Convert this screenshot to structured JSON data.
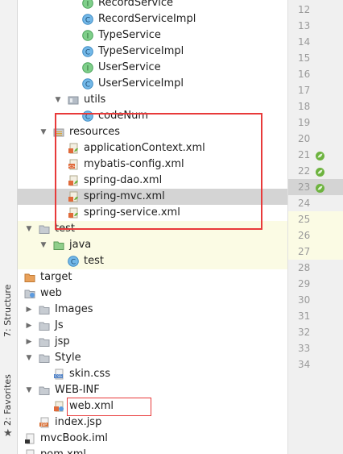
{
  "side_tabs": {
    "structure": "7: Structure",
    "favorites": "2: Favorites"
  },
  "tree": [
    {
      "label": "RecordService",
      "indent": 2,
      "icon": "interface-icon",
      "arrow": ""
    },
    {
      "label": "RecordServiceImpl",
      "indent": 2,
      "icon": "class-icon",
      "arrow": ""
    },
    {
      "label": "TypeService",
      "indent": 2,
      "icon": "interface-icon",
      "arrow": ""
    },
    {
      "label": "TypeServiceImpl",
      "indent": 2,
      "icon": "class-icon",
      "arrow": ""
    },
    {
      "label": "UserService",
      "indent": 2,
      "icon": "interface-icon",
      "arrow": ""
    },
    {
      "label": "UserServiceImpl",
      "indent": 2,
      "icon": "class-icon",
      "arrow": ""
    },
    {
      "label": "utils",
      "indent": 1,
      "icon": "package-icon",
      "arrow": "down"
    },
    {
      "label": "codeNum",
      "indent": 2,
      "icon": "class-icon",
      "arrow": ""
    },
    {
      "label": "resources",
      "indent": 0,
      "icon": "resources-folder-icon",
      "arrow": "down"
    },
    {
      "label": "applicationContext.xml",
      "indent": 1,
      "icon": "xml-spring-icon",
      "arrow": ""
    },
    {
      "label": "mybatis-config.xml",
      "indent": 1,
      "icon": "xml-icon",
      "arrow": ""
    },
    {
      "label": "spring-dao.xml",
      "indent": 1,
      "icon": "xml-spring-icon",
      "arrow": ""
    },
    {
      "label": "spring-mvc.xml",
      "indent": 1,
      "icon": "xml-spring-icon",
      "arrow": ""
    },
    {
      "label": "spring-service.xml",
      "indent": 1,
      "icon": "xml-spring-icon",
      "arrow": ""
    },
    {
      "label": "test",
      "indent": -1,
      "icon": "folder-icon",
      "arrow": "down"
    },
    {
      "label": "java",
      "indent": 0,
      "icon": "test-source-folder-icon",
      "arrow": "down"
    },
    {
      "label": "test",
      "indent": 1,
      "icon": "class-icon",
      "arrow": ""
    },
    {
      "label": "target",
      "indent": -2,
      "icon": "excluded-folder-icon",
      "arrow": "right"
    },
    {
      "label": "web",
      "indent": -2,
      "icon": "web-folder-icon",
      "arrow": "down"
    },
    {
      "label": "Images",
      "indent": -1,
      "icon": "folder-icon",
      "arrow": "right"
    },
    {
      "label": "Js",
      "indent": -1,
      "icon": "folder-icon",
      "arrow": "right"
    },
    {
      "label": "jsp",
      "indent": -1,
      "icon": "folder-icon",
      "arrow": "right"
    },
    {
      "label": "Style",
      "indent": -1,
      "icon": "folder-icon",
      "arrow": "down"
    },
    {
      "label": "skin.css",
      "indent": 0,
      "icon": "css-file-icon",
      "arrow": ""
    },
    {
      "label": "WEB-INF",
      "indent": -1,
      "icon": "folder-icon",
      "arrow": "down"
    },
    {
      "label": "web.xml",
      "indent": 0,
      "icon": "web-xml-icon",
      "arrow": ""
    },
    {
      "label": "index.jsp",
      "indent": -1,
      "icon": "jsp-file-icon",
      "arrow": ""
    },
    {
      "label": "mvcBook.iml",
      "indent": -2,
      "icon": "iml-file-icon",
      "arrow": ""
    },
    {
      "label": "pom.xml",
      "indent": -2,
      "icon": "maven-icon",
      "arrow": ""
    }
  ],
  "line_numbers": [
    "12",
    "13",
    "14",
    "15",
    "16",
    "17",
    "18",
    "19",
    "20",
    "21",
    "22",
    "23",
    "24",
    "25",
    "26",
    "27",
    "28",
    "29",
    "30",
    "31",
    "32",
    "33",
    "34"
  ],
  "colors": {
    "selected_row": "#d4d4d4",
    "test_row": "#fbfbe4",
    "highlight_box": "#e83a3a"
  }
}
